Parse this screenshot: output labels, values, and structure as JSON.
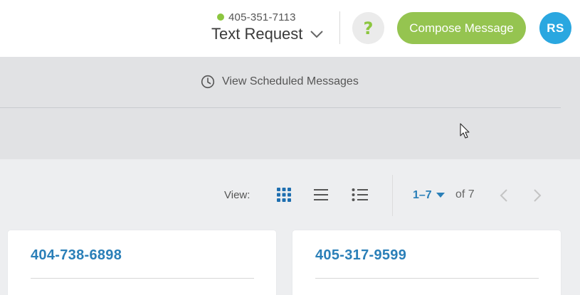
{
  "header": {
    "account_phone": "405-351-7113",
    "account_name": "Text Request",
    "help_label": "?",
    "compose_label": "Compose Message",
    "avatar_initials": "RS"
  },
  "scheduled": {
    "label": "View Scheduled Messages",
    "icon": "clock-icon"
  },
  "toolbar": {
    "view_label": "View:",
    "views": [
      {
        "icon": "grid-view-icon",
        "active": true
      },
      {
        "icon": "list-view-icon",
        "active": false
      },
      {
        "icon": "detail-list-view-icon",
        "active": false
      }
    ],
    "page_range": "1–7",
    "page_of": "of 7"
  },
  "cards": [
    {
      "title": "404-738-6898"
    },
    {
      "title": "405-317-9599"
    }
  ],
  "colors": {
    "brand_green": "#95c450",
    "status_green": "#8cc63f",
    "avatar_blue": "#2aa7e0",
    "link_blue": "#2a7fb8"
  }
}
